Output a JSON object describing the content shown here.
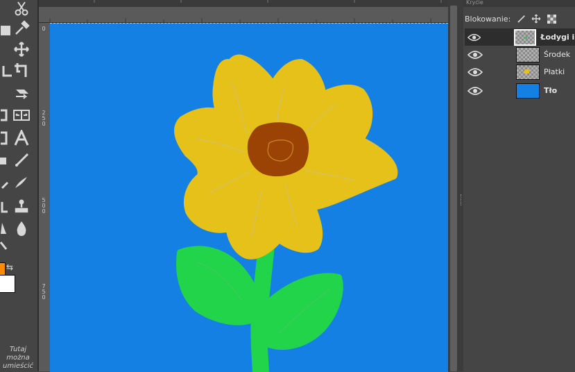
{
  "toolbox": {
    "fg_color": "#ff8c00",
    "bg_color": "#ffffff",
    "hint": [
      "Tutaj",
      "można",
      "umieścić"
    ],
    "tools": [
      "scissors-icon",
      "color-picker-icon",
      "move-icon",
      "align-icon",
      "crop-icon",
      "transform-icon",
      "flip-icon",
      "cage-icon",
      "text-icon",
      "paintbrush-icon",
      "ink-icon",
      "clone-icon",
      "blur-icon",
      "smudge-icon"
    ]
  },
  "ruler_left": {
    "labels": [
      {
        "text": [
          "0"
        ]
      },
      {
        "text": [
          "2",
          "5",
          "0"
        ]
      },
      {
        "text": [
          "5",
          "0",
          "0"
        ]
      },
      {
        "text": [
          "7",
          "5",
          "0"
        ]
      }
    ]
  },
  "canvas": {
    "background": "#1580e3",
    "petal_color": "#e5c11a",
    "center_color": "#9a4304",
    "stem_color": "#21d44a"
  },
  "layers_panel": {
    "tab_label": "Kryćie",
    "lock_label": "Blokowanie:",
    "layers": [
      {
        "name": "Łodygi i l",
        "active": true
      },
      {
        "name": "Środek",
        "active": false
      },
      {
        "name": "Płatki",
        "active": false
      },
      {
        "name": "Tło",
        "active": false
      }
    ]
  }
}
